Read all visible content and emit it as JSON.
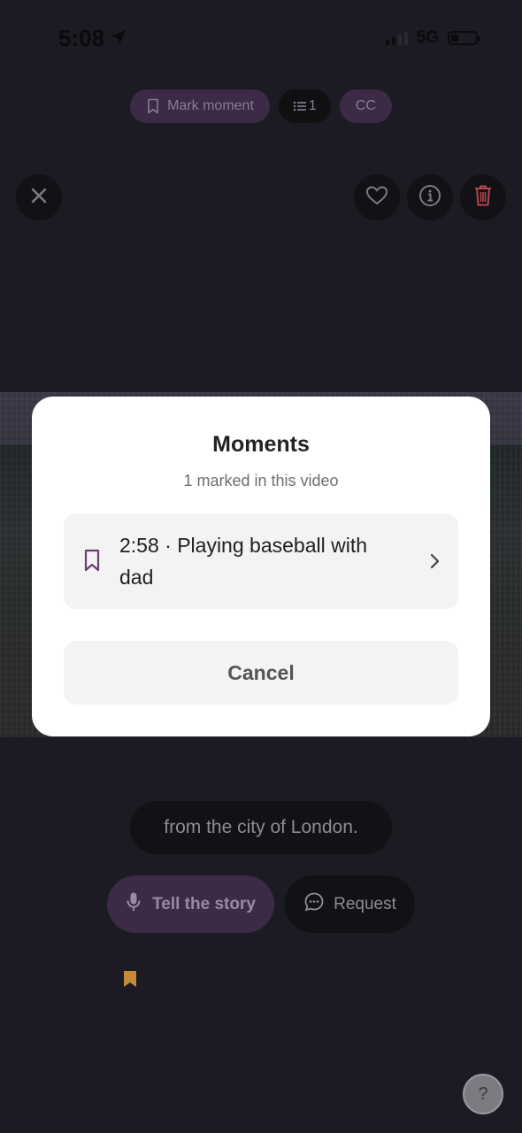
{
  "status_bar": {
    "time": "5:08",
    "network": "5G"
  },
  "top_pills": {
    "mark_moment_label": "Mark moment",
    "moments_count_label": "1",
    "cc_label": "CC"
  },
  "modal": {
    "title": "Moments",
    "subtitle": "1 marked in this video",
    "items": [
      {
        "label": "2:58 · Playing baseball with dad"
      }
    ],
    "cancel_label": "Cancel"
  },
  "caption": {
    "text": "from the city of London."
  },
  "actions": {
    "tell_story_label": "Tell the story",
    "request_label": "Request"
  },
  "help": {
    "label": "?"
  },
  "colors": {
    "background": "#1c1a22",
    "accent_purple": "#3d2a46",
    "bookmark_purple": "#6b3d73",
    "gold": "#c48a3a",
    "trash_red": "#b3454a"
  },
  "icons": {
    "location": "location-arrow-icon",
    "bookmark": "bookmark-icon",
    "list": "list-icon",
    "close": "close-icon",
    "heart": "heart-icon",
    "info": "info-icon",
    "trash": "trash-icon",
    "chevron": "chevron-right-icon",
    "microphone": "microphone-icon",
    "chat": "chat-bubble-icon"
  }
}
